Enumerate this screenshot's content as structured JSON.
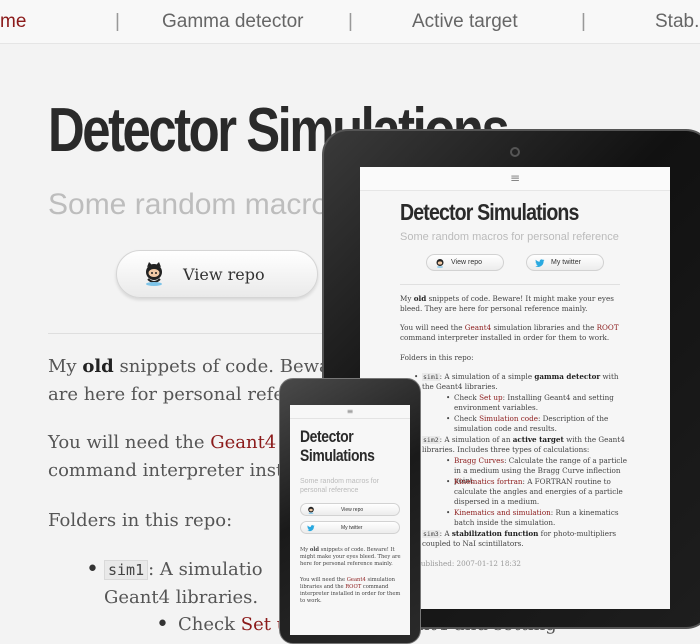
{
  "nav": {
    "items": [
      "me",
      "Gamma detector",
      "Active target",
      "Stab."
    ],
    "separator": "|"
  },
  "page": {
    "title": "Detector Simulations",
    "subtitle_visible": "Some random macros f",
    "view_repo": "View repo",
    "intro_1a": "My ",
    "intro_1b": "old",
    "intro_1c": " snippets of code. Beware",
    "intro_2": "are here for personal refere",
    "need_1a": "You will need the ",
    "need_1b": "Geant4",
    "need_1c": " s",
    "need_2": "command interpreter insta",
    "folders": "Folders in this repo:",
    "sim1_code": "sim1",
    "sim1_text": ": A simulatio",
    "sim1_text2": "Geant4 libraries.",
    "check_a": "Check ",
    "check_b": "Set u",
    "check_c": "nt4 and setting"
  },
  "tablet": {
    "menu_icon": "≡",
    "title": "Detector Simulations",
    "subtitle": "Some random macros for personal reference",
    "view_repo": "View repo",
    "my_twitter": "My twitter",
    "p1a": "My ",
    "p1b": "old",
    "p1c": " snippets of code. Beware! It might make your eyes bleed. They are here for personal reference mainly.",
    "p2a": "You will need the ",
    "p2b": "Geant4",
    "p2c": " simulation libraries and the ",
    "p2d": "ROOT",
    "p2e": " command interpreter installed in order for them to work.",
    "folders": "Folders in this repo:",
    "sim1_code": "sim1",
    "sim1a": ": A simulation of a simple ",
    "sim1b": "gamma detector",
    "sim1c": " with the Geant4 libraries.",
    "b1a": "Check ",
    "b1b": "Set up",
    "b1c": ": Installing Geant4 and setting environment variables.",
    "b2a": "Check ",
    "b2b": "Simulation code",
    "b2c": ": Description of the simulation code and results.",
    "sim2_code": "sim2",
    "sim2a": ": A simulation of an ",
    "sim2b": "active target",
    "sim2c": " with the Geant4 libraries. Includes three types of calculations:",
    "c1a": "Bragg Curves",
    "c1b": ": Calculate the range of a particle in a medium using the Bragg Curve inflection point.",
    "c2a": "Kinematics fortran",
    "c2b": ": A FORTRAN routine to calculate the angles and energies of a particle dispersed in a medium.",
    "c3a": "Kinematics and simulation",
    "c3b": ": Run a kinematics batch inside the simulation.",
    "sim3_code": "sim3",
    "sim3a": ": A ",
    "sim3b": "stabilization function",
    "sim3c": " for photo-multipliers coupled to NaI scintillators.",
    "published": "Published: 2007-01-12 18:32"
  },
  "phone": {
    "menu_icon": "≡",
    "title": "Detector Simulations",
    "subtitle": "Some random macros for personal reference",
    "view_repo": "View repo",
    "my_twitter": "My twitter",
    "p1a": "My ",
    "p1b": "old",
    "p1c": " snippets of code. Beware! It might make your eyes bleed. They are here for personal reference mainly.",
    "p2a": "You will need the ",
    "p2b": "Geant4",
    "p2c": " simulation libraries and the ",
    "p2d": "ROOT",
    "p2e": " command interpreter installed in order for them to work."
  },
  "colors": {
    "accent": "#8b1a1a",
    "twitter": "#2aa9e0"
  },
  "icons": [
    "octocat-icon",
    "twitter-icon",
    "menu-icon",
    "bullet-icon"
  ]
}
